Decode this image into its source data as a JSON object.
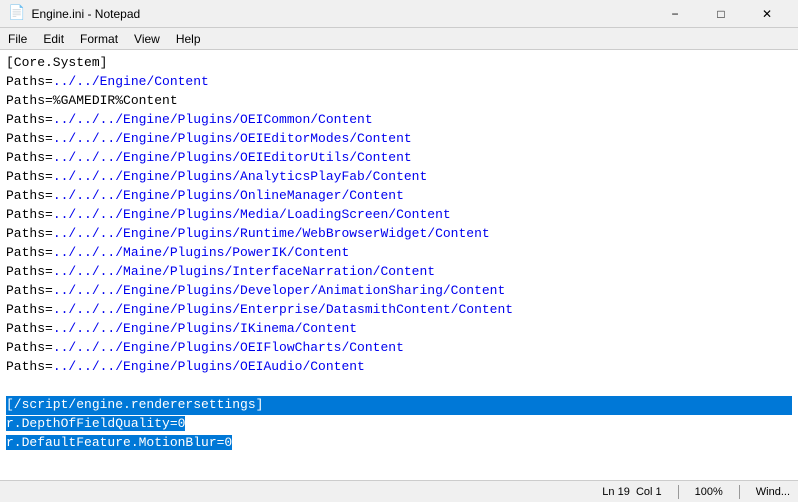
{
  "window": {
    "title": "Engine.ini - Notepad",
    "icon": "📄"
  },
  "menu": {
    "items": [
      "File",
      "Edit",
      "Format",
      "View",
      "Help"
    ]
  },
  "editor": {
    "lines": [
      {
        "text": "[Core.System]",
        "highlight": false,
        "link": false
      },
      {
        "text": "Paths=../../Engine/Content",
        "highlight": false,
        "link": false
      },
      {
        "text": "Paths=%GAMEDIR%Content",
        "highlight": false,
        "link": false
      },
      {
        "text": "Paths=../../../Engine/Plugins/OEICommon/Content",
        "highlight": false,
        "link": false
      },
      {
        "text": "Paths=../../../Engine/Plugins/OEIEditorModes/Content",
        "highlight": false,
        "link": false
      },
      {
        "text": "Paths=../../../Engine/Plugins/OEIEditorUtils/Content",
        "highlight": false,
        "link": false
      },
      {
        "text": "Paths=../../../Engine/Plugins/AnalyticsPlayFab/Content",
        "highlight": false,
        "link": false
      },
      {
        "text": "Paths=../../../Engine/Plugins/OnlineManager/Content",
        "highlight": false,
        "link": false
      },
      {
        "text": "Paths=../../../Engine/Plugins/Media/LoadingScreen/Content",
        "highlight": false,
        "link": false
      },
      {
        "text": "Paths=../../../Engine/Plugins/Runtime/WebBrowserWidget/Content",
        "highlight": false,
        "link": false
      },
      {
        "text": "Paths=../../../Maine/Plugins/PowerIK/Content",
        "highlight": false,
        "link": false
      },
      {
        "text": "Paths=../../../Maine/Plugins/InterfaceNarration/Content",
        "highlight": false,
        "link": false
      },
      {
        "text": "Paths=../../../Engine/Plugins/Developer/AnimationSharing/Content",
        "highlight": false,
        "link": false
      },
      {
        "text": "Paths=../../../Engine/Plugins/Enterprise/DatasmithContent/Content",
        "highlight": false,
        "link": false
      },
      {
        "text": "Paths=../../../Engine/Plugins/IKinema/Content",
        "highlight": false,
        "link": false
      },
      {
        "text": "Paths=../../../Engine/Plugins/OEIFlowCharts/Content",
        "highlight": false,
        "link": false
      },
      {
        "text": "Paths=../../../Engine/Plugins/OEIAudio/Content",
        "highlight": false,
        "link": false
      },
      {
        "text": "",
        "highlight": false,
        "link": false
      },
      {
        "text": "[/script/engine.renderersettings]",
        "highlight": true,
        "link": false
      },
      {
        "text": "r.DepthOfFieldQuality=0",
        "highlight": true,
        "partial_highlight": true,
        "highlight_end": 24,
        "link": false
      },
      {
        "text": "r.DefaultFeature.MotionBlur=0",
        "highlight": true,
        "partial_highlight": true,
        "highlight_end": 29,
        "link": false
      }
    ]
  },
  "status_bar": {
    "ln": "Ln 19",
    "col": "Col 1",
    "zoom": "100%",
    "line_ending": "Wind..."
  }
}
